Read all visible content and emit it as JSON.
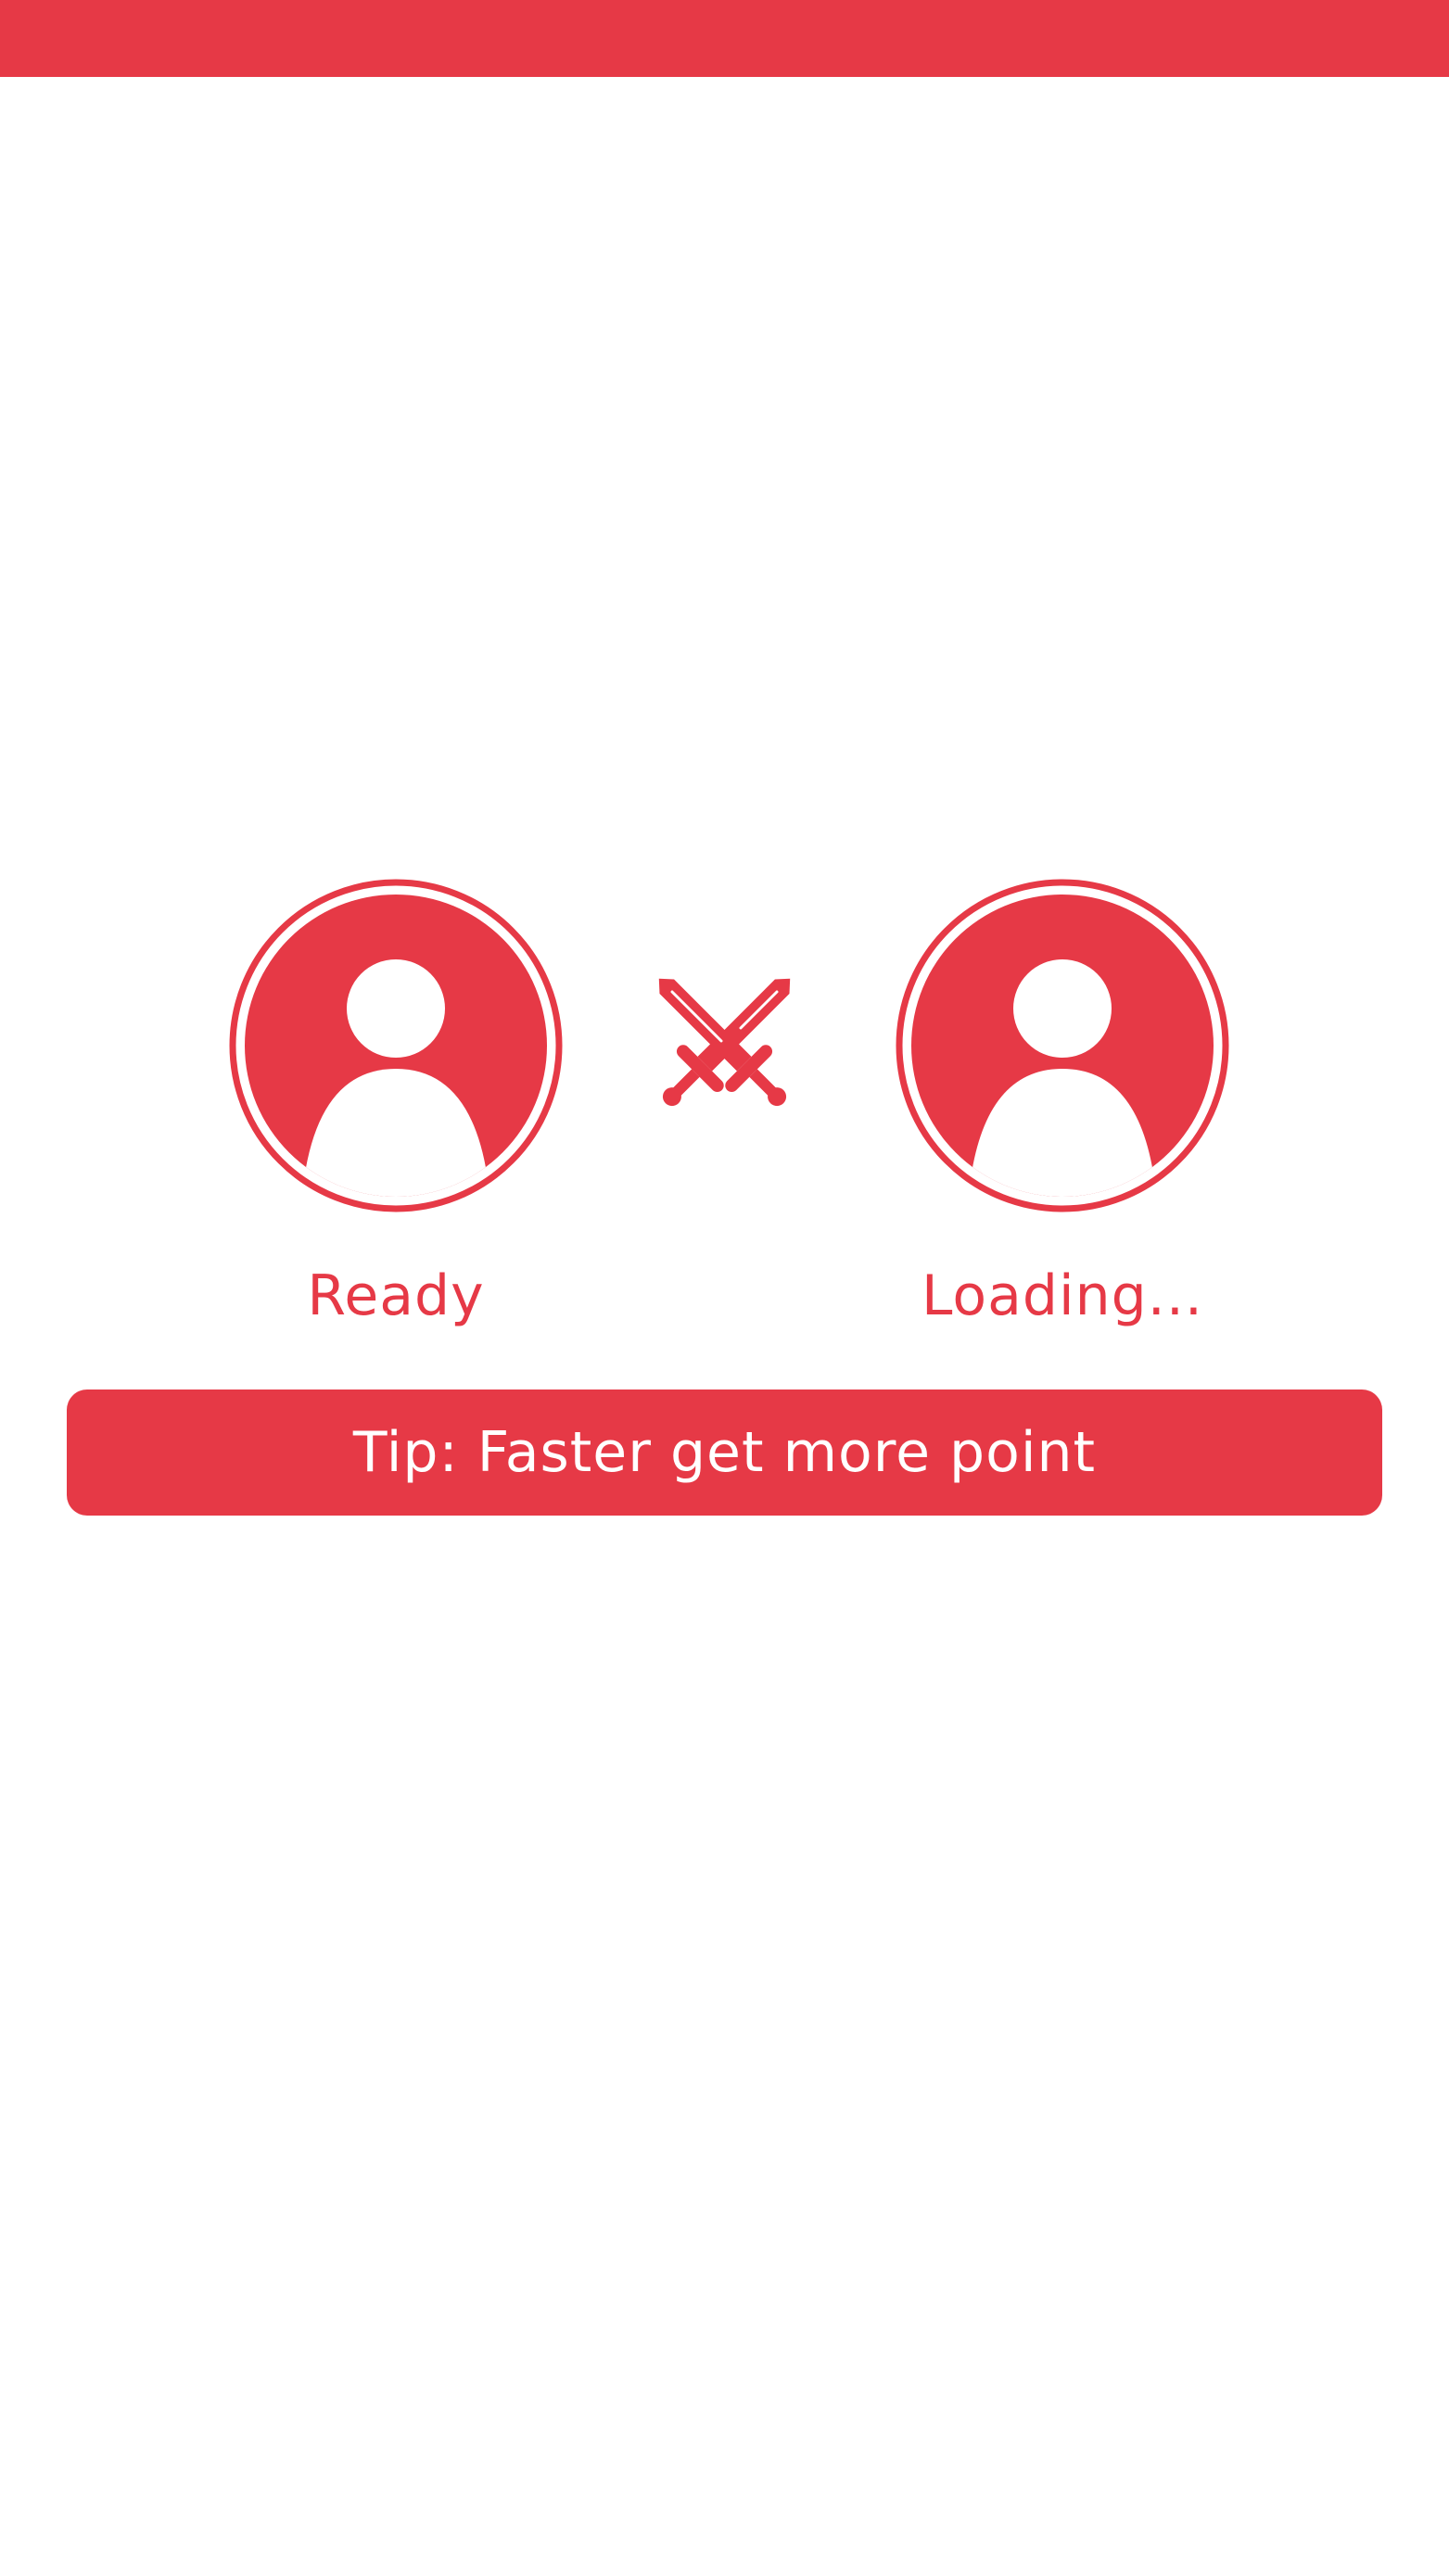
{
  "colors": {
    "accent": "#e63946",
    "background": "#ffffff",
    "tip_text": "#ffffff"
  },
  "players": [
    {
      "icon": "user-avatar-icon",
      "status": "Ready"
    },
    {
      "icon": "user-avatar-icon",
      "status": "Loading..."
    }
  ],
  "versus_icon": "crossed-swords-icon",
  "tip": {
    "text": "Tip: Faster get more point"
  }
}
